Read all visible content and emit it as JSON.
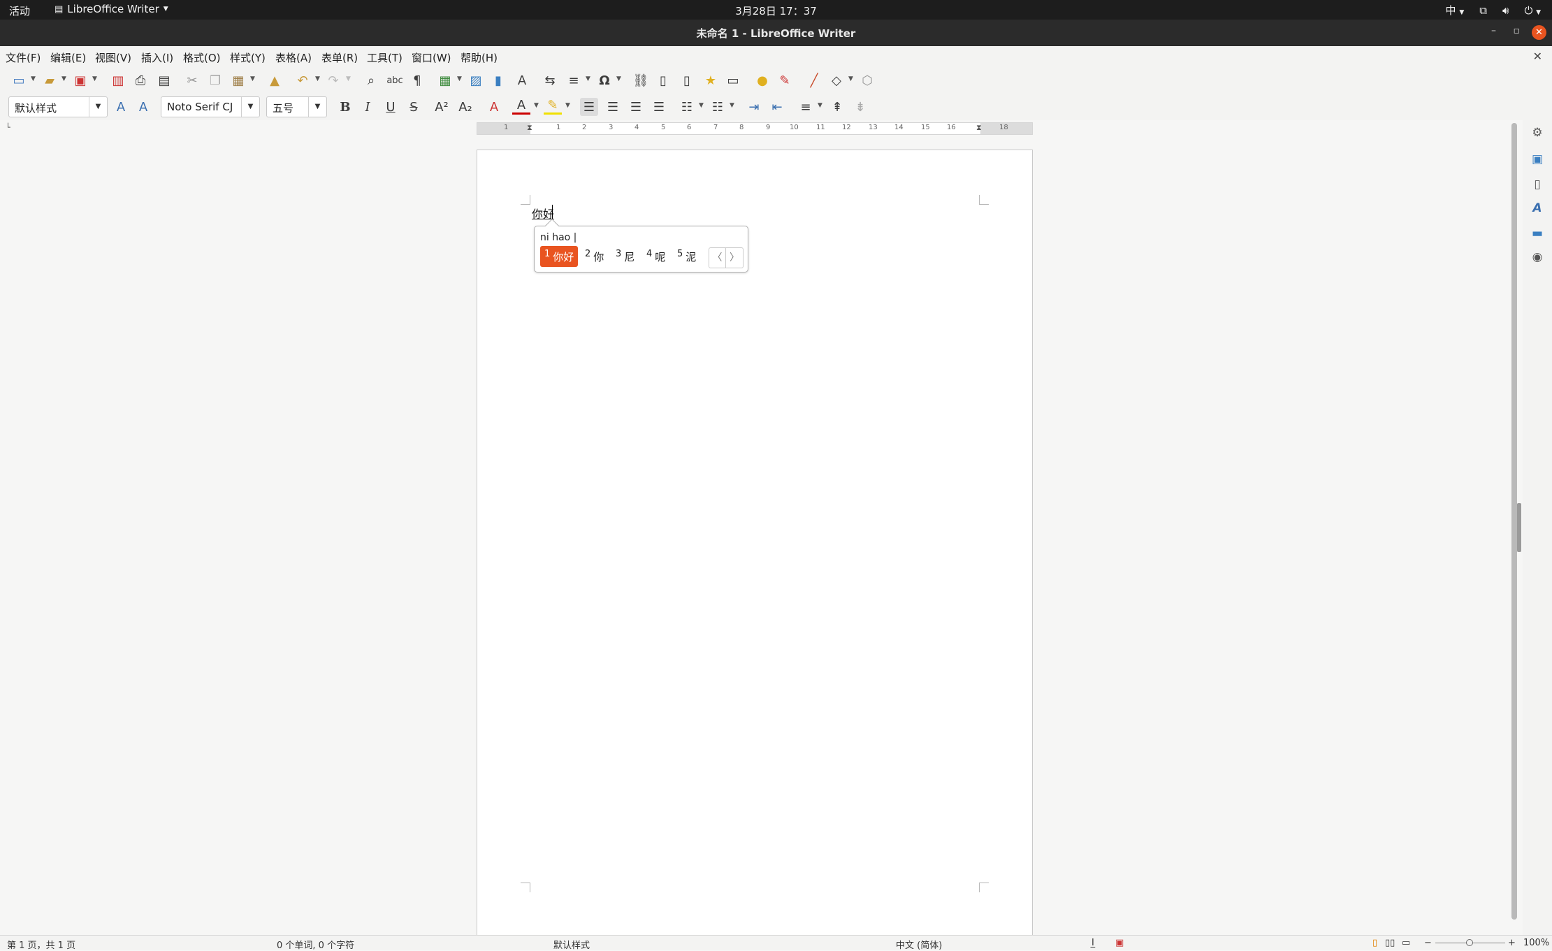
{
  "topbar": {
    "activities": "活动",
    "app_name": "LibreOffice Writer",
    "clock": "3月28日 17：37",
    "input_method": "中"
  },
  "window": {
    "title": "未命名 1 - LibreOffice Writer"
  },
  "menu": [
    "文件(F)",
    "编辑(E)",
    "视图(V)",
    "插入(I)",
    "格式(O)",
    "样式(Y)",
    "表格(A)",
    "表单(R)",
    "工具(T)",
    "窗口(W)",
    "帮助(H)"
  ],
  "format_toolbar": {
    "paragraph_style": "默认样式",
    "font_name": "Noto Serif CJ",
    "font_size": "五号"
  },
  "ruler": [
    "1",
    "1",
    "2",
    "3",
    "4",
    "5",
    "6",
    "7",
    "8",
    "9",
    "10",
    "11",
    "12",
    "13",
    "14",
    "15",
    "16",
    "18"
  ],
  "document": {
    "text": "你好"
  },
  "ime": {
    "preedit": "ni hao |",
    "candidates": [
      {
        "num": "1",
        "text": "你好"
      },
      {
        "num": "2",
        "text": "你"
      },
      {
        "num": "3",
        "text": "尼"
      },
      {
        "num": "4",
        "text": "呢"
      },
      {
        "num": "5",
        "text": "泥"
      }
    ],
    "prev": "〈",
    "next": "〉"
  },
  "statusbar": {
    "page": "第 1 页，共 1 页",
    "words": "0 个单词, 0 个字符",
    "style": "默认样式",
    "language": "中文 (简体)",
    "zoom": "100%"
  },
  "colors": {
    "accent": "#e95420",
    "topbar_bg": "#1d1d1d",
    "titlebar_bg": "#2b2b2b"
  }
}
